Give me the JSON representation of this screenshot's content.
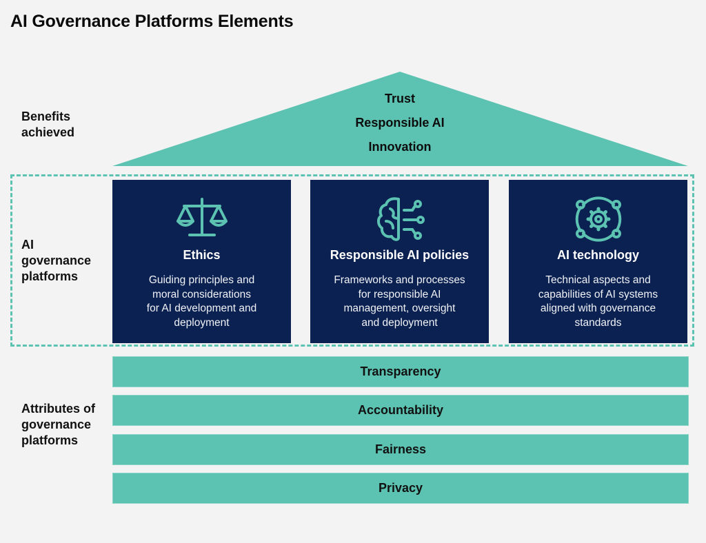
{
  "title": "AI Governance Platforms Elements",
  "colors": {
    "background": "#f3f3f3",
    "teal": "#5cc2b1",
    "navy": "#0b2152",
    "text_dark": "#111111",
    "text_light": "#ffffff"
  },
  "side_labels": {
    "benefits": [
      "Benefits",
      "achieved"
    ],
    "platforms": [
      "AI",
      "governance",
      "platforms"
    ],
    "attributes": [
      "Attributes of",
      "governance",
      "platforms"
    ]
  },
  "benefits": [
    "Trust",
    "Responsible AI",
    "Innovation"
  ],
  "pillars": [
    {
      "icon": "scales-icon",
      "title": "Ethics",
      "description_lines": [
        "Guiding principles and",
        "moral considerations",
        "for AI development and",
        "deployment"
      ]
    },
    {
      "icon": "brain-circuit-icon",
      "title": "Responsible AI policies",
      "description_lines": [
        "Frameworks and processes",
        "for responsible AI",
        "management, oversight",
        "and deployment"
      ]
    },
    {
      "icon": "gear-network-icon",
      "title": "AI technology",
      "description_lines": [
        "Technical aspects and",
        "capabilities of AI systems",
        "aligned with governance",
        "standards"
      ]
    }
  ],
  "attributes": [
    "Transparency",
    "Accountability",
    "Fairness",
    "Privacy"
  ]
}
